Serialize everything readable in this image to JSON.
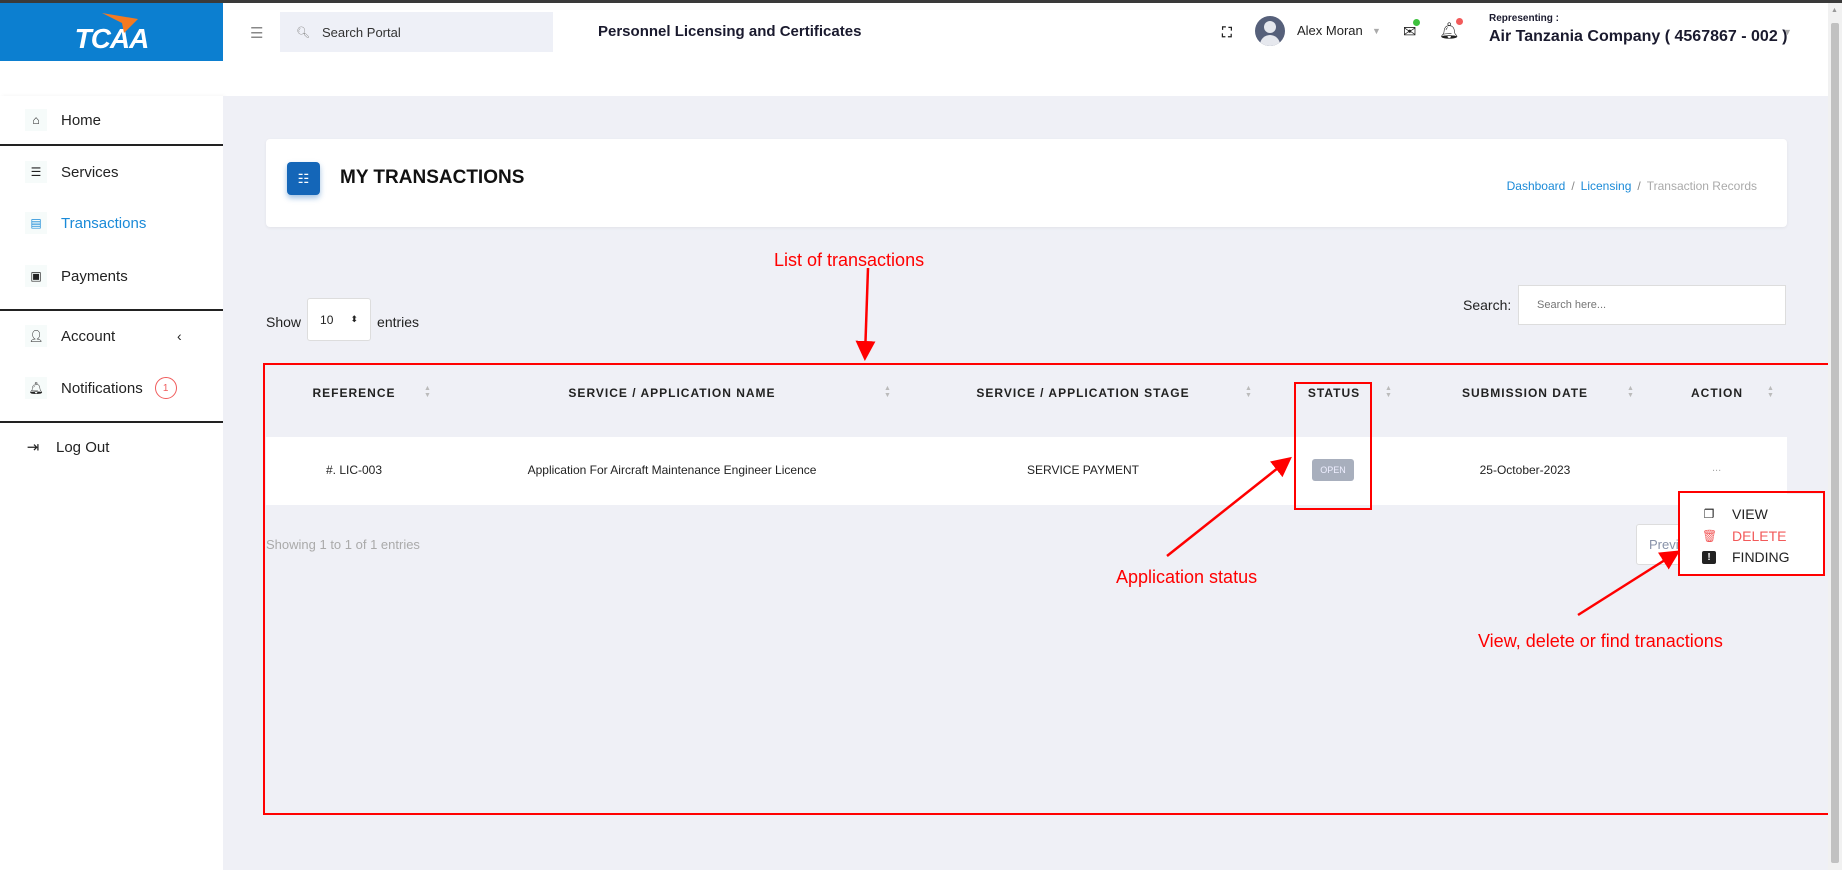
{
  "header": {
    "logo_text": "TCAA",
    "search_placeholder": "Search Portal",
    "app_title": "Personnel Licensing and Certificates",
    "user_name": "Alex Moran",
    "representing_label": "Representing :",
    "company": "Air Tanzania Company ( 4567867 - 002 )",
    "mail_dot_color": "#3ec13e",
    "bell_dot_color": "#f25a5a"
  },
  "sidebar": {
    "items": [
      {
        "label": "Home",
        "icon": "home-icon"
      },
      {
        "label": "Services",
        "icon": "list-icon"
      },
      {
        "label": "Transactions",
        "icon": "document-icon",
        "active": true
      },
      {
        "label": "Payments",
        "icon": "money-icon"
      },
      {
        "label": "Account",
        "icon": "user-icon"
      },
      {
        "label": "Notifications",
        "icon": "bell-icon",
        "badge": "1"
      },
      {
        "label": "Log Out",
        "icon": "logout-icon"
      }
    ]
  },
  "page": {
    "title": "MY TRANSACTIONS",
    "breadcrumb": [
      "Dashboard",
      "Licensing",
      "Transaction Records"
    ]
  },
  "table": {
    "show_label": "Show",
    "entries_value": "10",
    "entries_label": "entries",
    "search_label": "Search:",
    "search_placeholder": "Search here...",
    "columns": [
      "REFERENCE",
      "SERVICE / APPLICATION NAME",
      "SERVICE / APPLICATION STAGE",
      "STATUS",
      "SUBMISSION DATE",
      "ACTION"
    ],
    "rows": [
      {
        "reference": "#. LIC-003",
        "name": "Application For Aircraft Maintenance Engineer Licence",
        "stage": "SERVICE PAYMENT",
        "status": "OPEN",
        "date": "25-October-2023",
        "action": "..."
      }
    ],
    "info": "Showing 1 to 1 of 1 entries",
    "prev_label": "Previous"
  },
  "action_menu": [
    {
      "label": "VIEW",
      "icon": "copy-icon"
    },
    {
      "label": "DELETE",
      "icon": "trash-icon",
      "color": "#f25a5a"
    },
    {
      "label": "FINDING",
      "icon": "exclamation-icon"
    }
  ],
  "annotations": {
    "list": "List of transactions",
    "status": "Application status",
    "actions": "View, delete or find tranactions",
    "color": "#ff0000"
  }
}
